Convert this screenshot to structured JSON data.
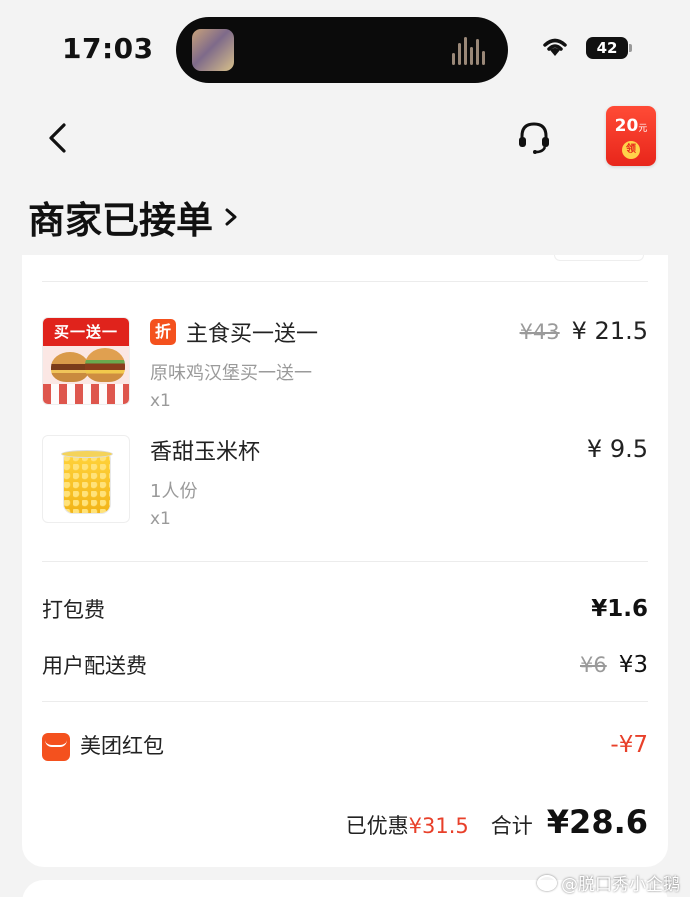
{
  "status_bar": {
    "time": "17:03",
    "battery": "42"
  },
  "nav": {
    "redpacket": {
      "amount": "20",
      "unit": "元",
      "seal": "领"
    }
  },
  "order_status": "商家已接单",
  "items": [
    {
      "thumb_banner": "买一送一",
      "discount_tag": "折",
      "title": "主食买一送一",
      "subtitle": "原味鸡汉堡买一送一",
      "qty": "x1",
      "original_price": "¥43",
      "price": "¥ 21.5"
    },
    {
      "title": "香甜玉米杯",
      "subtitle": "1人份",
      "qty": "x1",
      "price": "¥ 9.5"
    }
  ],
  "fees": {
    "packing": {
      "label": "打包费",
      "value": "¥1.6"
    },
    "delivery": {
      "label": "用户配送费",
      "original": "¥6",
      "value": "¥3"
    }
  },
  "coupon": {
    "label": "美团红包",
    "value": "-¥7"
  },
  "summary": {
    "saved_label": "已优惠",
    "saved_value": "¥31.5",
    "total_label": "合计",
    "total_value": "¥28.6"
  },
  "watermark": "@脱口秀小企鹅",
  "colors": {
    "accent": "#f4511e",
    "discount": "#e8402a",
    "redpacket": "#e8261b"
  }
}
